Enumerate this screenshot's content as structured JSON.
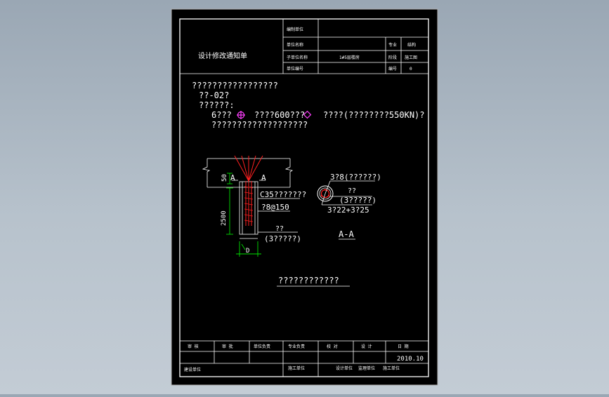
{
  "title_block": {
    "title": "设计修改通知单",
    "rows": [
      {
        "label": "编制单位",
        "value": "",
        "side_label": "",
        "side_value": ""
      },
      {
        "label": "单位名称",
        "value": "",
        "side_label": "专业",
        "side_value": "结构"
      },
      {
        "label": "子单位名称",
        "value": "1#5层楼房",
        "side_label": "阶段",
        "side_value": "施工图"
      },
      {
        "label": "单位编号",
        "value": "",
        "side_label": "编号",
        "side_value": "0"
      }
    ]
  },
  "notes": {
    "line1": "?????????????????",
    "line2": "??-02?",
    "line3": "??????:",
    "line4_a": "6???",
    "line4_b": "????600???",
    "line4_c": "????(????????550KN)?",
    "line5": "???????????????????"
  },
  "pile_detail": {
    "label_a_left": "A",
    "label_a_right": "A",
    "dim_50": "50",
    "dim_2500": "2500",
    "dim_d": "D",
    "concrete": "C35???????",
    "stirrup": "?8@150",
    "rebar_word": "??",
    "rebar_note": "(3?????)"
  },
  "section": {
    "top": "3?8(??????)",
    "mid_word": "??",
    "mid_note": "(3?????)",
    "bottom": "3?22+3?25",
    "label": "A-A"
  },
  "bottom_note": "????????????",
  "footer": {
    "headers": [
      "审 核",
      "审 批",
      "单位负责",
      "专业负责",
      "校 对",
      "设 计",
      "日 期"
    ],
    "date": "2010.10",
    "row3": [
      "建设单位",
      "施工单位",
      "设计单位",
      "监理单位",
      "施工单位",
      "监理单位"
    ]
  },
  "colors": {
    "background": "#000000",
    "lines": "#ffffff",
    "pile": "#ff2020",
    "dimension": "#00e000",
    "marker": "#ff40ff"
  }
}
